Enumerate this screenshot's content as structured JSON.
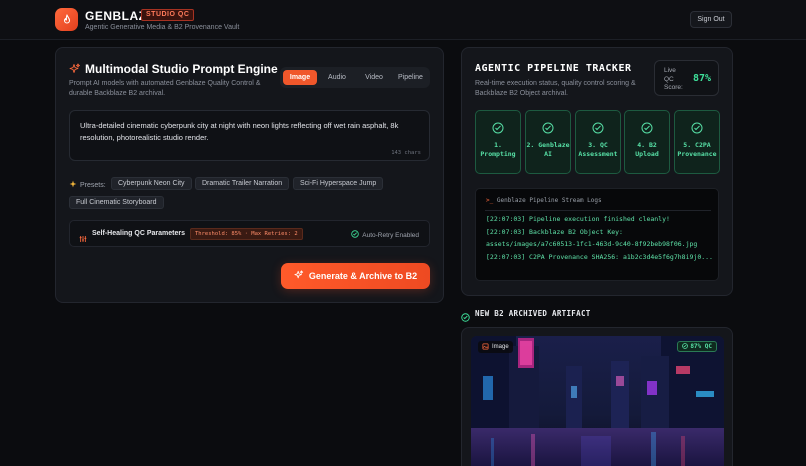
{
  "header": {
    "brand": "GENBLAZE",
    "badge": "STUDIO QC",
    "subtitle": "Agentic Generative Media & B2 Provenance Vault",
    "signout": "Sign Out"
  },
  "studio": {
    "title": "Multimodal Studio Prompt Engine",
    "description": "Prompt AI models with automated Genblaze Quality Control & durable Backblaze B2 archival.",
    "tabs": [
      {
        "label": "Image",
        "active": true
      },
      {
        "label": "Audio",
        "active": false
      },
      {
        "label": "Video",
        "active": false
      },
      {
        "label": "Pipeline",
        "active": false
      }
    ],
    "prompt": "Ultra-detailed cinematic cyberpunk city at night with neon lights reflecting off wet rain asphalt, 8k resolution, photorealistic studio render.",
    "char_count": "143 chars",
    "presets_label": "Presets:",
    "presets": [
      "Cyberpunk Neon City",
      "Dramatic Trailer Narration",
      "Sci-Fi Hyperspace Jump",
      "Full Cinematic Storyboard"
    ],
    "qc": {
      "title": "Self-Healing QC Parameters",
      "params": "Threshold: 85% · Max Retries: 2",
      "auto_retry": "Auto-Retry Enabled"
    },
    "generate_label": "Generate & Archive to B2"
  },
  "tracker": {
    "title": "AGENTIC PIPELINE TRACKER",
    "description": "Real-time execution status, quality control scoring & Backblaze B2 Object archival.",
    "score_label": "Live QC Score:",
    "score_value": "87%",
    "steps": [
      {
        "label": "1. Prompting"
      },
      {
        "label": "2. Genblaze AI"
      },
      {
        "label": "3. QC Assessment"
      },
      {
        "label": "4. B2 Upload"
      },
      {
        "label": "5. C2PA Provenance"
      }
    ],
    "logs_title": "Genblaze Pipeline Stream Logs",
    "logs": [
      "[22:07:03] Pipeline execution finished cleanly!",
      "[22:07:03] Backblaze B2 Object Key: assets/images/a7c60513-1fc1-463d-9c40-8f92beb98f06.jpg",
      "[22:07:03] C2PA Provenance SHA256: a1b2c3d4e5f6g7h8i9j0..."
    ]
  },
  "artifact": {
    "title": "NEW B2 ARCHIVED ARTIFACT",
    "type_badge": "Image",
    "qc_badge": "87% QC"
  },
  "colors": {
    "accent": "#f0572b",
    "success": "#57e0a6",
    "panel": "#14161b",
    "background": "#0b0c0f"
  }
}
